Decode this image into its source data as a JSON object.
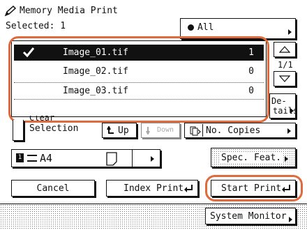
{
  "header": {
    "title": "Memory Media Print",
    "selected_label": "Selected: 1"
  },
  "filter": {
    "label": "All"
  },
  "file_list": {
    "items": [
      {
        "name": "Image_01.tif",
        "copies": "1",
        "selected": true
      },
      {
        "name": "Image_02.tif",
        "copies": "0",
        "selected": false
      },
      {
        "name": "Image_03.tif",
        "copies": "0",
        "selected": false
      }
    ]
  },
  "pager": {
    "page": "1/1"
  },
  "details": {
    "label_top": "De-",
    "label_bottom": "tails"
  },
  "actions": {
    "clear_top": "Clear",
    "clear_bottom": "Selection",
    "up": "Up",
    "down": "Down",
    "no_copies": "No. Copies",
    "paper_size": "A4",
    "spec_feat": "Spec. Feat.",
    "cancel": "Cancel",
    "index_print": "Index Print",
    "start_print": "Start Print",
    "system_monitor": "System Monitor"
  },
  "colors": {
    "highlight": "#e06a3b",
    "selected_row": "#111111"
  }
}
